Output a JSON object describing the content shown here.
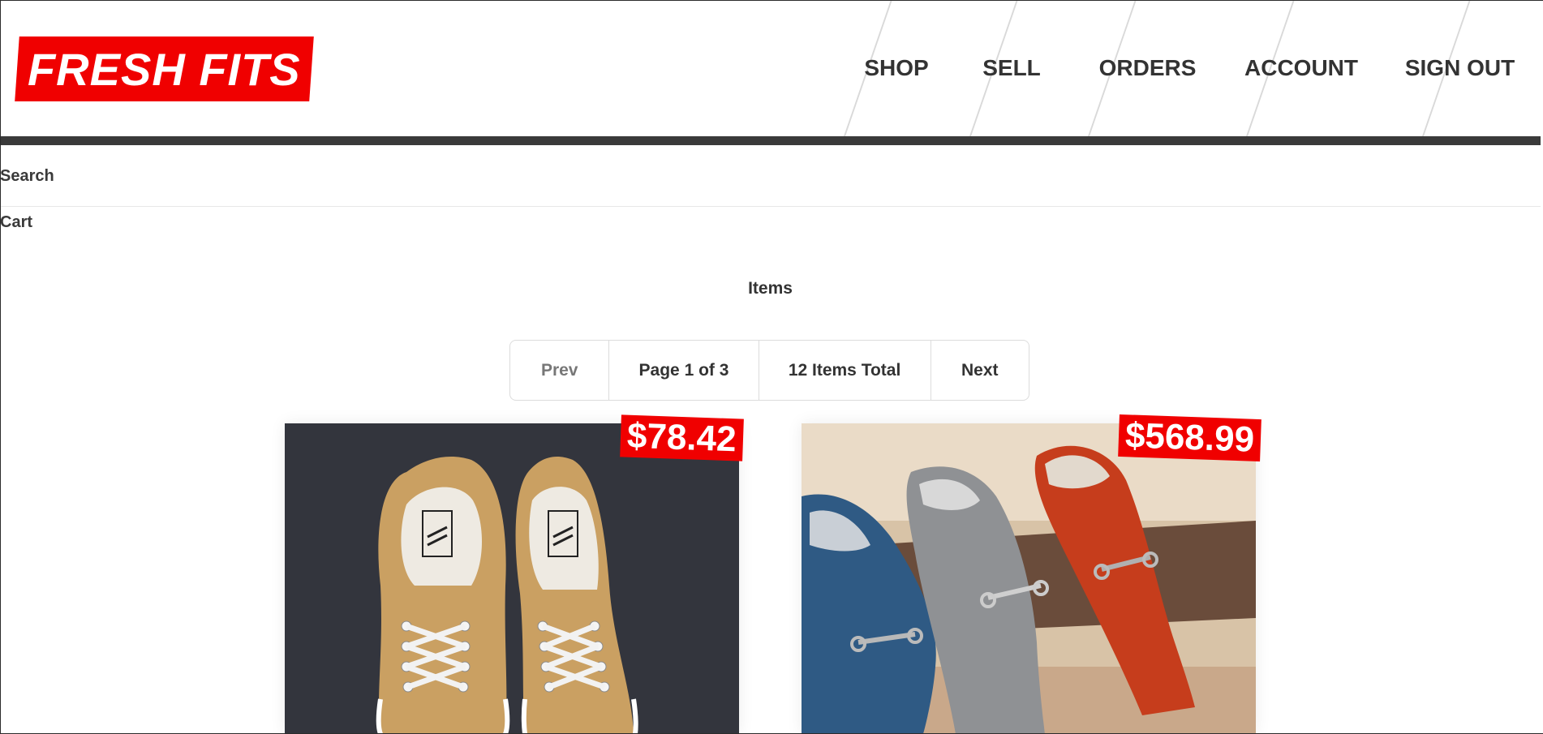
{
  "brand": {
    "name": "FRESH FITS",
    "color": "#f00000"
  },
  "nav": {
    "items": [
      {
        "label": "SHOP"
      },
      {
        "label": "SELL"
      },
      {
        "label": "ORDERS"
      },
      {
        "label": "ACCOUNT"
      },
      {
        "label": "SIGN OUT"
      }
    ]
  },
  "sidebar": {
    "search_label": "Search",
    "cart_label": "Cart"
  },
  "main": {
    "title": "Items",
    "pagination": {
      "prev_label": "Prev",
      "page_label": "Page 1 of 3",
      "total_label": "12 Items Total",
      "next_label": "Next"
    },
    "products": [
      {
        "price": "$78.42",
        "image": "mustard-canvas-sneakers"
      },
      {
        "price": "$568.99",
        "image": "croc-leather-loafers-blue-grey-orange"
      }
    ]
  },
  "colors": {
    "accent": "#f00000",
    "dark_bar": "#3a3a3a",
    "text": "#333333"
  }
}
